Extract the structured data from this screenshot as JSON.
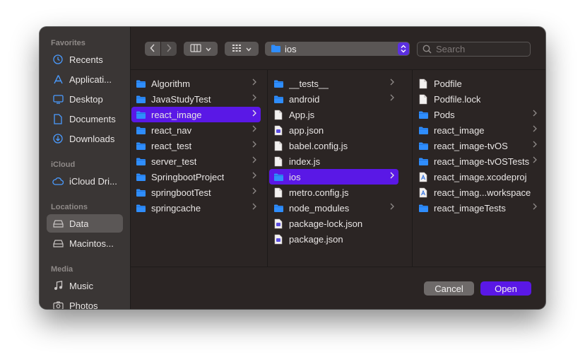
{
  "colors": {
    "accent": "#5a18e6",
    "folder": "#2f8dfc",
    "window": "#2b2524",
    "sidebar": "#3a3635"
  },
  "sidebar": {
    "favorites_header": "Favorites",
    "favorites": [
      {
        "label": "Recents",
        "icon": "clock-icon"
      },
      {
        "label": "Applicati...",
        "icon": "applications-icon"
      },
      {
        "label": "Desktop",
        "icon": "desktop-icon"
      },
      {
        "label": "Documents",
        "icon": "document-icon"
      },
      {
        "label": "Downloads",
        "icon": "download-icon"
      }
    ],
    "icloud_header": "iCloud",
    "icloud": [
      {
        "label": "iCloud Dri...",
        "icon": "cloud-icon"
      }
    ],
    "locations_header": "Locations",
    "locations": [
      {
        "label": "Data",
        "icon": "drive-icon",
        "selected": true
      },
      {
        "label": "Macintos...",
        "icon": "drive-icon"
      }
    ],
    "media_header": "Media",
    "media": [
      {
        "label": "Music",
        "icon": "music-icon"
      },
      {
        "label": "Photos",
        "icon": "camera-icon"
      }
    ]
  },
  "toolbar": {
    "path_label": "ios",
    "search_placeholder": "Search"
  },
  "columns": [
    [
      {
        "label": "Algorithm",
        "type": "folder"
      },
      {
        "label": "JavaStudyTest",
        "type": "folder"
      },
      {
        "label": "react_image",
        "type": "folder",
        "selected": true
      },
      {
        "label": "react_nav",
        "type": "folder"
      },
      {
        "label": "react_test",
        "type": "folder"
      },
      {
        "label": "server_test",
        "type": "folder"
      },
      {
        "label": "SpringbootProject",
        "type": "folder"
      },
      {
        "label": "springbootTest",
        "type": "folder"
      },
      {
        "label": "springcache",
        "type": "folder"
      }
    ],
    [
      {
        "label": "__tests__",
        "type": "folder"
      },
      {
        "label": "android",
        "type": "folder"
      },
      {
        "label": "App.js",
        "type": "file"
      },
      {
        "label": "app.json",
        "type": "json"
      },
      {
        "label": "babel.config.js",
        "type": "file"
      },
      {
        "label": "index.js",
        "type": "file"
      },
      {
        "label": "ios",
        "type": "folder",
        "selected": true
      },
      {
        "label": "metro.config.js",
        "type": "file"
      },
      {
        "label": "node_modules",
        "type": "folder"
      },
      {
        "label": "package-lock.json",
        "type": "json"
      },
      {
        "label": "package.json",
        "type": "json"
      }
    ],
    [
      {
        "label": "Podfile",
        "type": "file"
      },
      {
        "label": "Podfile.lock",
        "type": "file"
      },
      {
        "label": "Pods",
        "type": "folder"
      },
      {
        "label": "react_image",
        "type": "folder"
      },
      {
        "label": "react_image-tvOS",
        "type": "folder"
      },
      {
        "label": "react_image-tvOSTests",
        "type": "folder"
      },
      {
        "label": "react_image.xcodeproj",
        "type": "xcode"
      },
      {
        "label": "react_imag...workspace",
        "type": "xcode"
      },
      {
        "label": "react_imageTests",
        "type": "folder"
      }
    ]
  ],
  "buttons": {
    "cancel": "Cancel",
    "open": "Open"
  }
}
